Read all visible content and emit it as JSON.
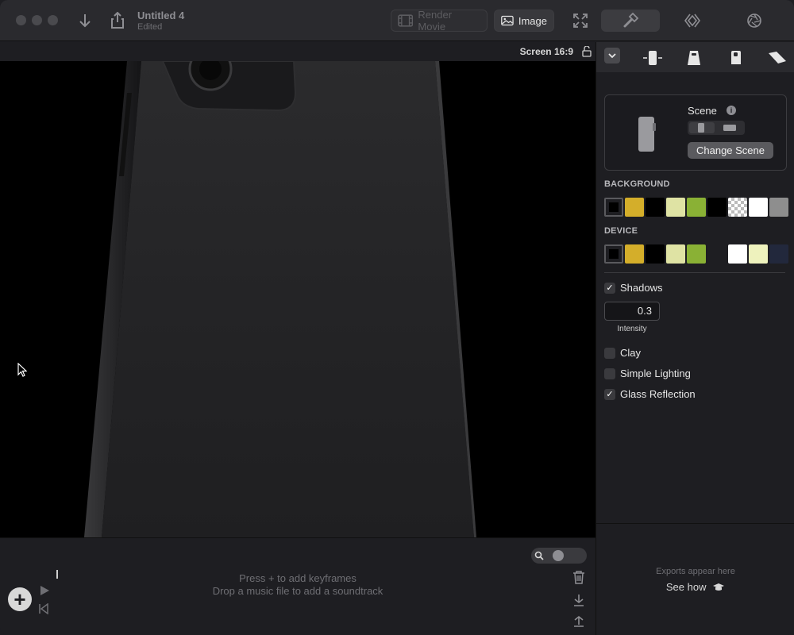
{
  "titlebar": {
    "doc_title": "Untitled 4",
    "doc_status": "Edited",
    "render_movie_label": "Render Movie",
    "image_label": "Image"
  },
  "canvas": {
    "aspect_label": "Screen  16:9"
  },
  "timeline": {
    "hint_line1": "Press + to add keyframes",
    "hint_line2": "Drop a music file to add a soundtrack",
    "add_label": "+"
  },
  "sidebar": {
    "scene_label": "Scene",
    "change_scene_label": "Change Scene",
    "background_label": "BACKGROUND",
    "device_label": "DEVICE",
    "background_swatches": [
      "#000000",
      "#d4ae2a",
      "#000000",
      "#dfe3a4",
      "#8ab135",
      "#000000",
      "checker",
      "#ffffff",
      "#8e8e8e"
    ],
    "device_swatches": [
      "#000000",
      "#d4ae2a",
      "#000000",
      "#dfe3a4",
      "#8ab135",
      "#1e1e22",
      "#ffffff",
      "#eef2bd",
      "#22283c"
    ],
    "options": [
      {
        "label": "Shadows",
        "checked": true
      },
      {
        "label": "Clay",
        "checked": false
      },
      {
        "label": "Simple Lighting",
        "checked": false
      },
      {
        "label": "Glass Reflection",
        "checked": true
      }
    ],
    "intensity_value": "0.3",
    "intensity_label": "Intensity"
  },
  "exports": {
    "hint": "Exports appear here",
    "see_how": "See how"
  }
}
